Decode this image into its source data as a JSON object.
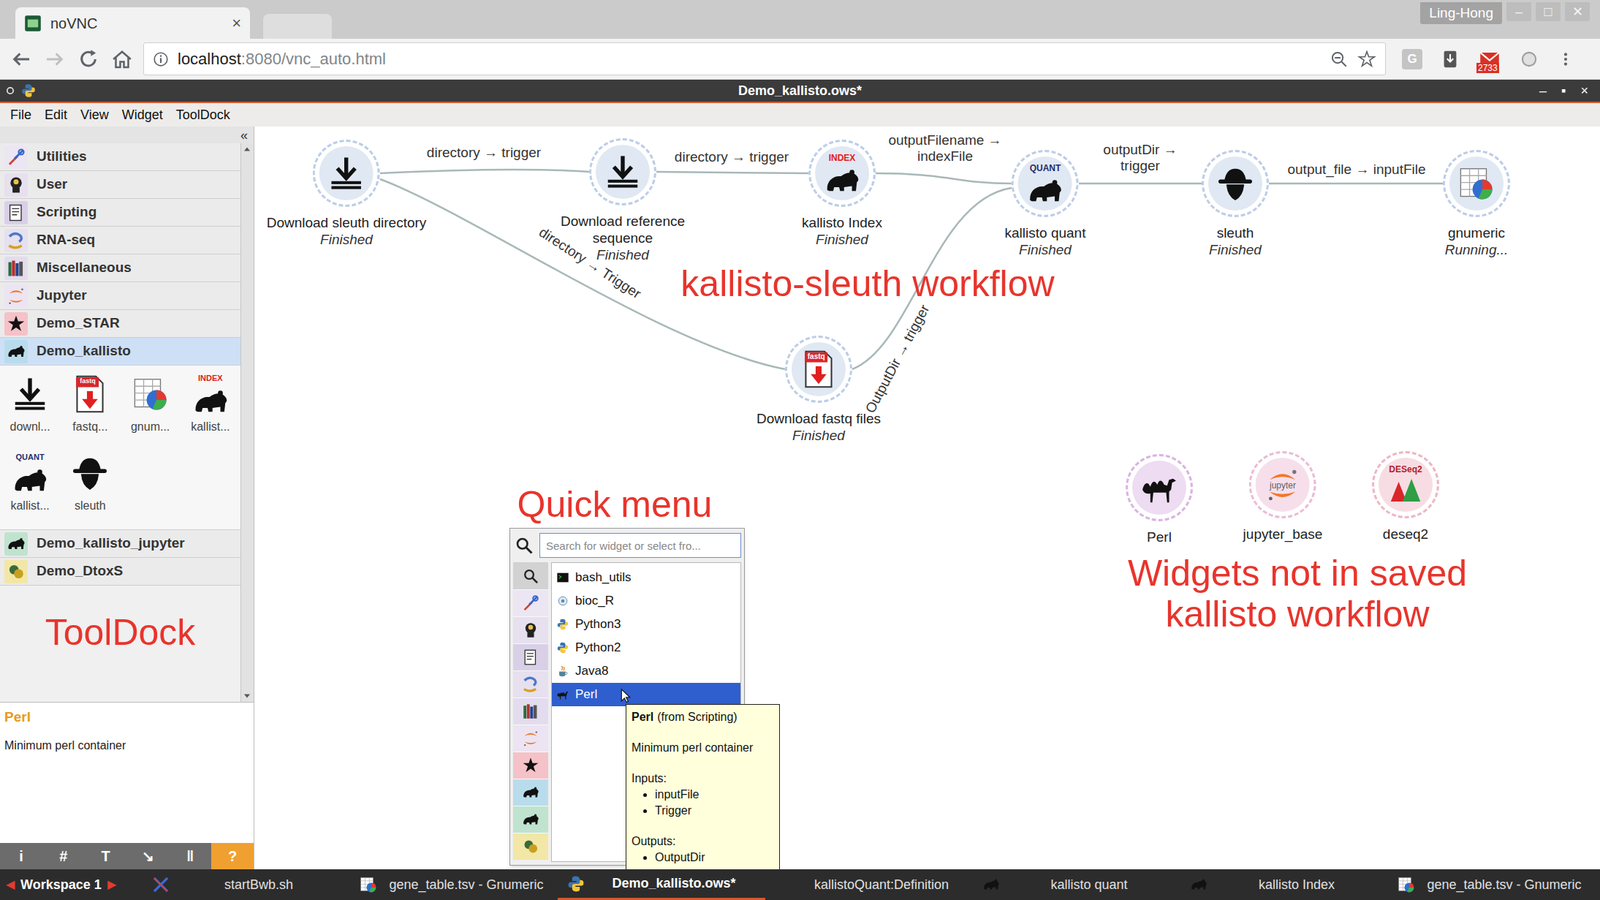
{
  "browser": {
    "tabs": [
      {
        "label": "noVNC",
        "close": "×",
        "selected": true
      },
      {
        "selected": false
      }
    ],
    "user": "Ling-Hong",
    "window_controls": [
      "–",
      "□",
      "✕"
    ],
    "nav": {
      "back_disabled": false,
      "forward_disabled": true
    },
    "url": {
      "host": "localhost",
      "rest": ":8080/vnc_auto.html"
    },
    "extension_letter": "G",
    "mail_count": "2733"
  },
  "app": {
    "title": "Demo_kallisto.ows*",
    "controls": [
      "–",
      "▪",
      "×"
    ]
  },
  "menu": [
    "File",
    "Edit",
    "View",
    "Widget",
    "ToolDock"
  ],
  "toolbox": {
    "collapse": "«",
    "categories": [
      {
        "label": "Utilities",
        "kind": "tools",
        "color": "#ece6f3",
        "selected": false
      },
      {
        "label": "User",
        "kind": "bulb",
        "color": "#e6e0ef",
        "selected": false
      },
      {
        "label": "Scripting",
        "kind": "script",
        "color": "#d9d0e8",
        "selected": false
      },
      {
        "label": "RNA-seq",
        "kind": "rnaseq",
        "color": "#e6e0ef",
        "selected": false
      },
      {
        "label": "Miscellaneous",
        "kind": "books",
        "color": "#e3dcee",
        "selected": false
      },
      {
        "label": "Jupyter",
        "kind": "jupyter",
        "color": "#ece4f2",
        "selected": false
      },
      {
        "label": "Demo_STAR",
        "kind": "star",
        "color": "#f4c2c8",
        "selected": false
      },
      {
        "label": "Demo_kallisto",
        "kind": "bear",
        "color": "#b9dcec",
        "selected": true,
        "widgets": [
          {
            "label": "downl...",
            "kind": "download"
          },
          {
            "label": "fastq...",
            "kind": "fastq",
            "icon_text": "fastq"
          },
          {
            "label": "gnum...",
            "kind": "gnumeric"
          },
          {
            "label": "kallist...",
            "kind": "index",
            "icon_text": "INDEX"
          },
          {
            "label": "kallist...",
            "kind": "quant",
            "icon_text": "QUANT"
          },
          {
            "label": "sleuth",
            "kind": "sleuth"
          }
        ]
      },
      {
        "label": "Demo_kallisto_jupyter",
        "kind": "bear",
        "color": "#bfe3cf",
        "selected": false
      },
      {
        "label": "Demo_DtoxS",
        "kind": "dtoxs",
        "color": "#f2e7a6",
        "selected": false
      }
    ]
  },
  "annotations": {
    "tooldock": "ToolDock",
    "workflow": "kallisto-sleuth workflow",
    "quick_menu": "Quick menu",
    "extra_widgets": [
      "Widgets not in saved",
      "kallisto workflow"
    ]
  },
  "description": {
    "title": "Perl",
    "text": "Minimum perl container"
  },
  "dock_toolbar": [
    {
      "label": "i",
      "highlighted": false
    },
    {
      "label": "#",
      "highlighted": false
    },
    {
      "label": "T",
      "highlighted": false
    },
    {
      "label": "↘",
      "highlighted": false
    },
    {
      "label": "‖",
      "highlighted": false
    },
    {
      "label": "?",
      "highlighted": true
    }
  ],
  "canvas": {
    "nodes": [
      {
        "label": [
          "Download sleuth directory"
        ],
        "status": "Finished",
        "kind": "download",
        "color": "#bccde6"
      },
      {
        "label": [
          "Download reference",
          "sequence"
        ],
        "status": "Finished",
        "kind": "download",
        "color": "#bccde6"
      },
      {
        "label": [
          "kallisto Index"
        ],
        "status": "Finished",
        "kind": "index",
        "icon_text": "INDEX",
        "color": "#bccde6"
      },
      {
        "label": [
          "kallisto quant"
        ],
        "status": "Finished",
        "kind": "quant",
        "icon_text": "QUANT",
        "color": "#bccde6"
      },
      {
        "label": [
          "sleuth"
        ],
        "status": "Finished",
        "kind": "sleuth",
        "color": "#bccde6"
      },
      {
        "label": [
          "gnumeric"
        ],
        "status": "Running...",
        "kind": "gnumeric",
        "color": "#bccde6"
      },
      {
        "label": [
          "Download fastq files"
        ],
        "status": "Finished",
        "kind": "fastq",
        "icon_text": "fastq",
        "color": "#bccde6"
      }
    ],
    "extra_nodes": [
      {
        "label": [
          "Perl"
        ],
        "kind": "camel",
        "color": "#d9b3e3"
      },
      {
        "label": [
          "jupyter_base"
        ],
        "kind": "jupyter",
        "icon_text": "jupyter",
        "color": "#ebbad5"
      },
      {
        "label": [
          "deseq2"
        ],
        "kind": "deseq",
        "icon_text": "DESeq2",
        "color": "#eeb6c3"
      }
    ],
    "links": [
      {
        "label": [
          "directory → trigger"
        ]
      },
      {
        "label": [
          "directory → trigger"
        ]
      },
      {
        "label": [
          "outputFilename →",
          "indexFile"
        ]
      },
      {
        "label": [
          "outputDir →",
          "trigger"
        ]
      },
      {
        "label": [
          "output_file → inputFile"
        ]
      },
      {
        "label": [
          "directory → Trigger"
        ]
      },
      {
        "label": [
          "OutputDir → trigger"
        ]
      }
    ]
  },
  "quick_menu": {
    "placeholder": "Search for widget or select fro...",
    "items": [
      {
        "label": "bash_utils",
        "kind": "terminal",
        "selected": false
      },
      {
        "label": "bioc_R",
        "kind": "bioc",
        "selected": false
      },
      {
        "label": "Python3",
        "kind": "python",
        "selected": false
      },
      {
        "label": "Python2",
        "kind": "python",
        "selected": false
      },
      {
        "label": "Java8",
        "kind": "java",
        "selected": false
      },
      {
        "label": "Perl",
        "kind": "camel",
        "selected": true
      }
    ],
    "tooltip": {
      "title": "Perl",
      "source": "(from Scripting)",
      "description": "Minimum perl container",
      "inputs_label": "Inputs:",
      "inputs": [
        "inputFile",
        "Trigger"
      ],
      "outputs_label": "Outputs:",
      "outputs": [
        "OutputDir"
      ]
    }
  },
  "taskbar": {
    "workspace": {
      "prev": "◀",
      "label": "Workspace 1",
      "next": "▶"
    },
    "items": [
      {
        "label": "startBwb.sh",
        "kind": "xterm",
        "selected": false
      },
      {
        "label": "gene_table.tsv - Gnumeric",
        "kind": "gnumeric",
        "selected": false
      },
      {
        "label": "Demo_kallisto.ows*",
        "kind": "python",
        "selected": true
      },
      {
        "label": "kallistoQuant:Definition",
        "kind": "none",
        "selected": false
      },
      {
        "label": "kallisto quant",
        "kind": "bear",
        "selected": false
      },
      {
        "label": "kallisto Index",
        "kind": "bear",
        "selected": false
      },
      {
        "label": "gene_table.tsv - Gnumeric",
        "kind": "gnumeric",
        "selected": false
      }
    ]
  }
}
